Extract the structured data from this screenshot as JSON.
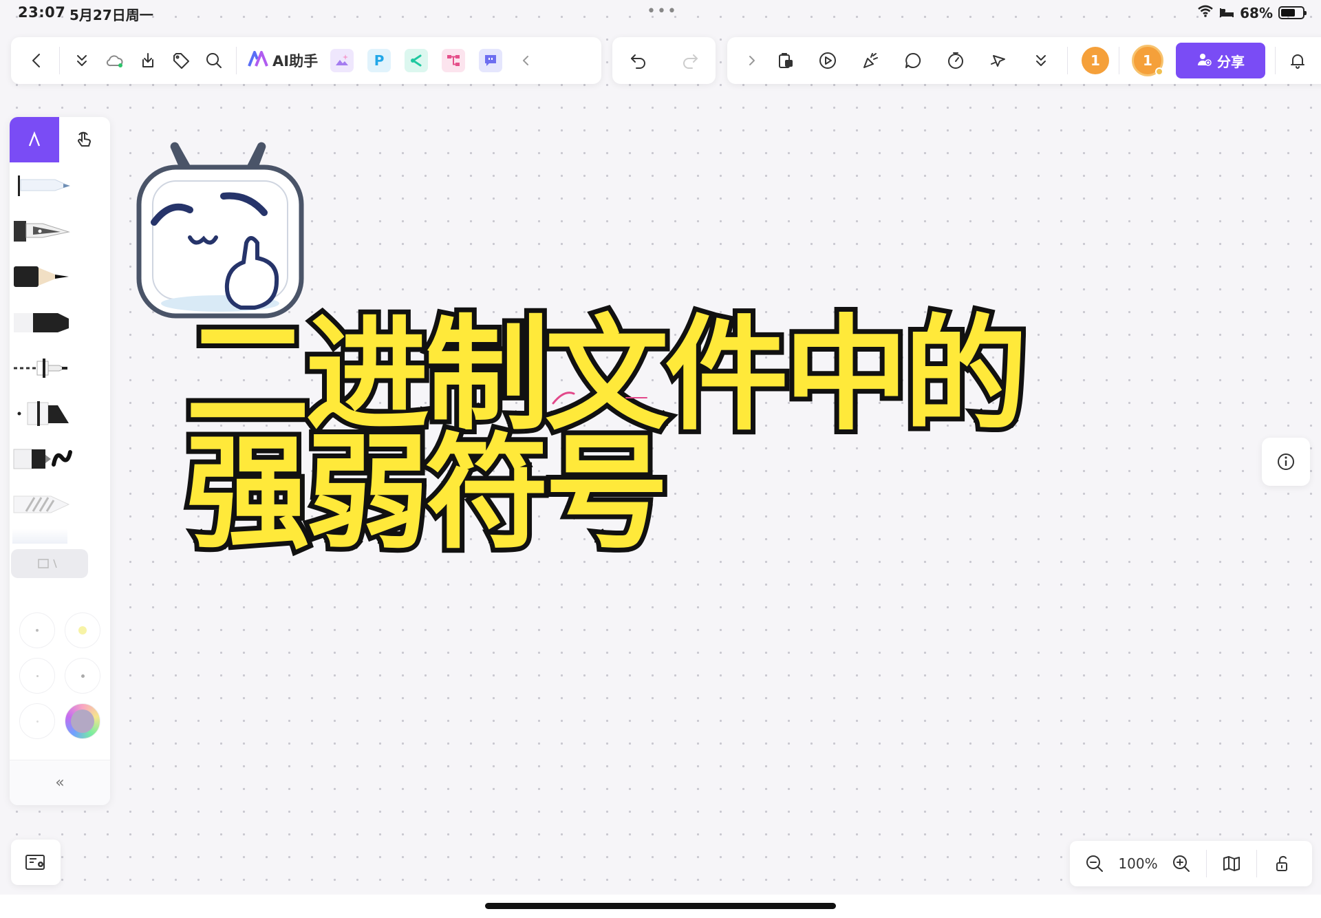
{
  "status_bar": {
    "time": "23:07",
    "date": "5月27日周一",
    "battery": "68%",
    "battery_level": 0.68
  },
  "toolbar_left": {
    "ai_label": "AI助手",
    "apps": [
      {
        "name": "image-app",
        "glyph": "",
        "color": "#a57cf0"
      },
      {
        "name": "p-app",
        "glyph": "P",
        "color": "#21a7e8"
      },
      {
        "name": "mindmap-app",
        "glyph": "",
        "color": "#1fc8a0"
      },
      {
        "name": "flow-app",
        "glyph": "",
        "color": "#e5508a"
      },
      {
        "name": "chat-app",
        "glyph": "",
        "color": "#6d6ef0"
      }
    ]
  },
  "toolbar_right": {
    "notification_count": "1",
    "avatar_initial": "1",
    "share_label": "分享"
  },
  "canvas": {
    "headline_line1": "二进制文件中的",
    "headline_line2": "强弱符号"
  },
  "zoom": {
    "level": "100%"
  },
  "colors": {
    "accent": "#7a4cf5",
    "headline": "#ffe93a",
    "badge": "#f5a03a"
  }
}
